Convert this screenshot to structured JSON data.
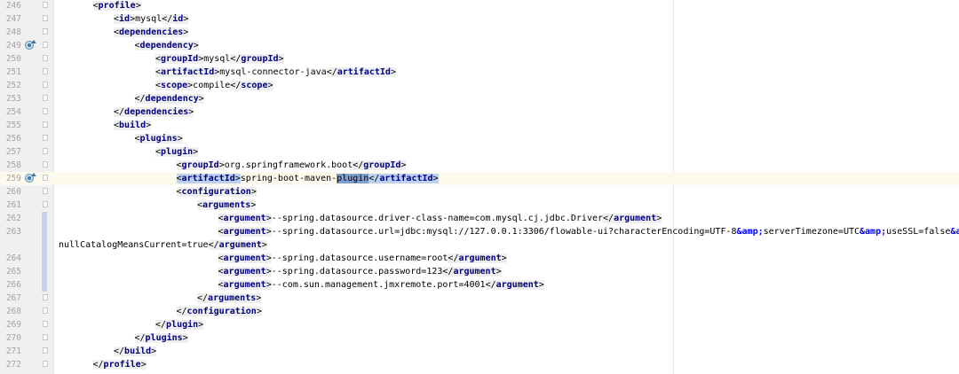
{
  "editor": {
    "lines": [
      {
        "num": "246",
        "indent": 3,
        "parts": [
          [
            "br",
            "<"
          ],
          [
            "tag",
            "profile"
          ],
          [
            "br",
            ">"
          ]
        ]
      },
      {
        "num": "247",
        "indent": 4,
        "parts": [
          [
            "br",
            "<"
          ],
          [
            "tag",
            "id"
          ],
          [
            "br",
            ">"
          ],
          [
            "t",
            "mysql"
          ],
          [
            "br",
            "</"
          ],
          [
            "tag",
            "id"
          ],
          [
            "br",
            ">"
          ]
        ]
      },
      {
        "num": "248",
        "indent": 4,
        "parts": [
          [
            "br",
            "<"
          ],
          [
            "tag",
            "dependencies"
          ],
          [
            "br",
            ">"
          ]
        ]
      },
      {
        "num": "249",
        "indent": 5,
        "marker": true,
        "parts": [
          [
            "br",
            "<"
          ],
          [
            "tag",
            "dependency"
          ],
          [
            "br",
            ">"
          ]
        ]
      },
      {
        "num": "250",
        "indent": 6,
        "parts": [
          [
            "br",
            "<"
          ],
          [
            "tag",
            "groupId"
          ],
          [
            "br",
            ">"
          ],
          [
            "t",
            "mysql"
          ],
          [
            "br",
            "</"
          ],
          [
            "tag",
            "groupId"
          ],
          [
            "br",
            ">"
          ]
        ]
      },
      {
        "num": "251",
        "indent": 6,
        "parts": [
          [
            "br",
            "<"
          ],
          [
            "tag",
            "artifactId"
          ],
          [
            "br",
            ">"
          ],
          [
            "t",
            "mysql-connector-java"
          ],
          [
            "br",
            "</"
          ],
          [
            "tag",
            "artifactId"
          ],
          [
            "br",
            ">"
          ]
        ]
      },
      {
        "num": "252",
        "indent": 6,
        "parts": [
          [
            "br",
            "<"
          ],
          [
            "tag",
            "scope"
          ],
          [
            "br",
            ">"
          ],
          [
            "t",
            "compile"
          ],
          [
            "br",
            "</"
          ],
          [
            "tag",
            "scope"
          ],
          [
            "br",
            ">"
          ]
        ]
      },
      {
        "num": "253",
        "indent": 5,
        "parts": [
          [
            "br",
            "</"
          ],
          [
            "tag",
            "dependency"
          ],
          [
            "br",
            ">"
          ]
        ]
      },
      {
        "num": "254",
        "indent": 4,
        "parts": [
          [
            "br",
            "</"
          ],
          [
            "tag",
            "dependencies"
          ],
          [
            "br",
            ">"
          ]
        ]
      },
      {
        "num": "255",
        "indent": 4,
        "parts": [
          [
            "br",
            "<"
          ],
          [
            "tag",
            "build"
          ],
          [
            "br",
            ">"
          ]
        ]
      },
      {
        "num": "256",
        "indent": 5,
        "parts": [
          [
            "br",
            "<"
          ],
          [
            "tag",
            "plugins"
          ],
          [
            "br",
            ">"
          ]
        ]
      },
      {
        "num": "257",
        "indent": 6,
        "parts": [
          [
            "br",
            "<"
          ],
          [
            "tag",
            "plugin"
          ],
          [
            "br",
            ">"
          ]
        ]
      },
      {
        "num": "258",
        "indent": 7,
        "parts": [
          [
            "br",
            "<"
          ],
          [
            "tag",
            "groupId"
          ],
          [
            "br",
            ">"
          ],
          [
            "t",
            "org.springframework.boot"
          ],
          [
            "br",
            "</"
          ],
          [
            "tag",
            "groupId"
          ],
          [
            "br",
            ">"
          ]
        ]
      },
      {
        "num": "259",
        "indent": 7,
        "marker": true,
        "current": true,
        "parts": [
          [
            "hbr",
            "<"
          ],
          [
            "htag",
            "artifactId"
          ],
          [
            "hbr",
            ">"
          ],
          [
            "t",
            "spring-boot-maven-"
          ],
          [
            "sel",
            "plugin"
          ],
          [
            "hbr",
            "</"
          ],
          [
            "htag",
            "artifactId"
          ],
          [
            "hbr",
            ">"
          ]
        ]
      },
      {
        "num": "260",
        "indent": 7,
        "parts": [
          [
            "br",
            "<"
          ],
          [
            "tag",
            "configuration"
          ],
          [
            "br",
            ">"
          ]
        ]
      },
      {
        "num": "261",
        "indent": 8,
        "parts": [
          [
            "br",
            "<"
          ],
          [
            "tag",
            "arguments"
          ],
          [
            "br",
            ">"
          ]
        ]
      },
      {
        "num": "262",
        "indent": 9,
        "change": true,
        "parts": [
          [
            "br",
            "<"
          ],
          [
            "tag",
            "argument"
          ],
          [
            "br",
            ">"
          ],
          [
            "t",
            "--spring.datasource.driver-class-name=com.mysql.cj.jdbc.Driver"
          ],
          [
            "br",
            "</"
          ],
          [
            "tag",
            "argument"
          ],
          [
            "br",
            ">"
          ]
        ]
      },
      {
        "num": "263",
        "indent": 9,
        "change": true,
        "parts": [
          [
            "br",
            "<"
          ],
          [
            "tag",
            "argument"
          ],
          [
            "br",
            ">"
          ],
          [
            "t",
            "--spring.datasource.url=jdbc:mysql://127.0.0.1:3306/flowable-ui?characterEncoding=UTF-8"
          ],
          [
            "ent",
            "&amp;"
          ],
          [
            "t",
            "serverTimezone=UTC"
          ],
          [
            "ent",
            "&amp;"
          ],
          [
            "t",
            "useSSL=false"
          ],
          [
            "ent",
            "&amp;"
          ]
        ]
      },
      {
        "num": "",
        "indent": 0,
        "change": true,
        "parts": [
          [
            "t",
            "nullCatalogMeansCurrent=true"
          ],
          [
            "br",
            "</"
          ],
          [
            "tag",
            "argument"
          ],
          [
            "br",
            ">"
          ]
        ]
      },
      {
        "num": "264",
        "indent": 9,
        "change": true,
        "parts": [
          [
            "br",
            "<"
          ],
          [
            "tag",
            "argument"
          ],
          [
            "br",
            ">"
          ],
          [
            "t",
            "--spring.datasource.username=root"
          ],
          [
            "br",
            "</"
          ],
          [
            "tag",
            "argument"
          ],
          [
            "br",
            ">"
          ]
        ]
      },
      {
        "num": "265",
        "indent": 9,
        "change": true,
        "parts": [
          [
            "br",
            "<"
          ],
          [
            "tag",
            "argument"
          ],
          [
            "br",
            ">"
          ],
          [
            "t",
            "--spring.datasource.password=123"
          ],
          [
            "br",
            "</"
          ],
          [
            "tag",
            "argument"
          ],
          [
            "br",
            ">"
          ]
        ]
      },
      {
        "num": "266",
        "indent": 9,
        "change": true,
        "parts": [
          [
            "br",
            "<"
          ],
          [
            "tag",
            "argument"
          ],
          [
            "br",
            ">"
          ],
          [
            "t",
            "--com.sun.management.jmxremote.port=4001"
          ],
          [
            "br",
            "</"
          ],
          [
            "tag",
            "argument"
          ],
          [
            "br",
            ">"
          ]
        ]
      },
      {
        "num": "267",
        "indent": 8,
        "parts": [
          [
            "br",
            "</"
          ],
          [
            "tag",
            "arguments"
          ],
          [
            "br",
            ">"
          ]
        ]
      },
      {
        "num": "268",
        "indent": 7,
        "parts": [
          [
            "br",
            "</"
          ],
          [
            "tag",
            "configuration"
          ],
          [
            "br",
            ">"
          ]
        ]
      },
      {
        "num": "269",
        "indent": 6,
        "parts": [
          [
            "br",
            "</"
          ],
          [
            "tag",
            "plugin"
          ],
          [
            "br",
            ">"
          ]
        ]
      },
      {
        "num": "270",
        "indent": 5,
        "parts": [
          [
            "br",
            "</"
          ],
          [
            "tag",
            "plugins"
          ],
          [
            "br",
            ">"
          ]
        ]
      },
      {
        "num": "271",
        "indent": 4,
        "parts": [
          [
            "br",
            "</"
          ],
          [
            "tag",
            "build"
          ],
          [
            "br",
            ">"
          ]
        ]
      },
      {
        "num": "272",
        "indent": 3,
        "parts": [
          [
            "br",
            "</"
          ],
          [
            "tag",
            "profile"
          ],
          [
            "br",
            ">"
          ]
        ]
      }
    ]
  }
}
